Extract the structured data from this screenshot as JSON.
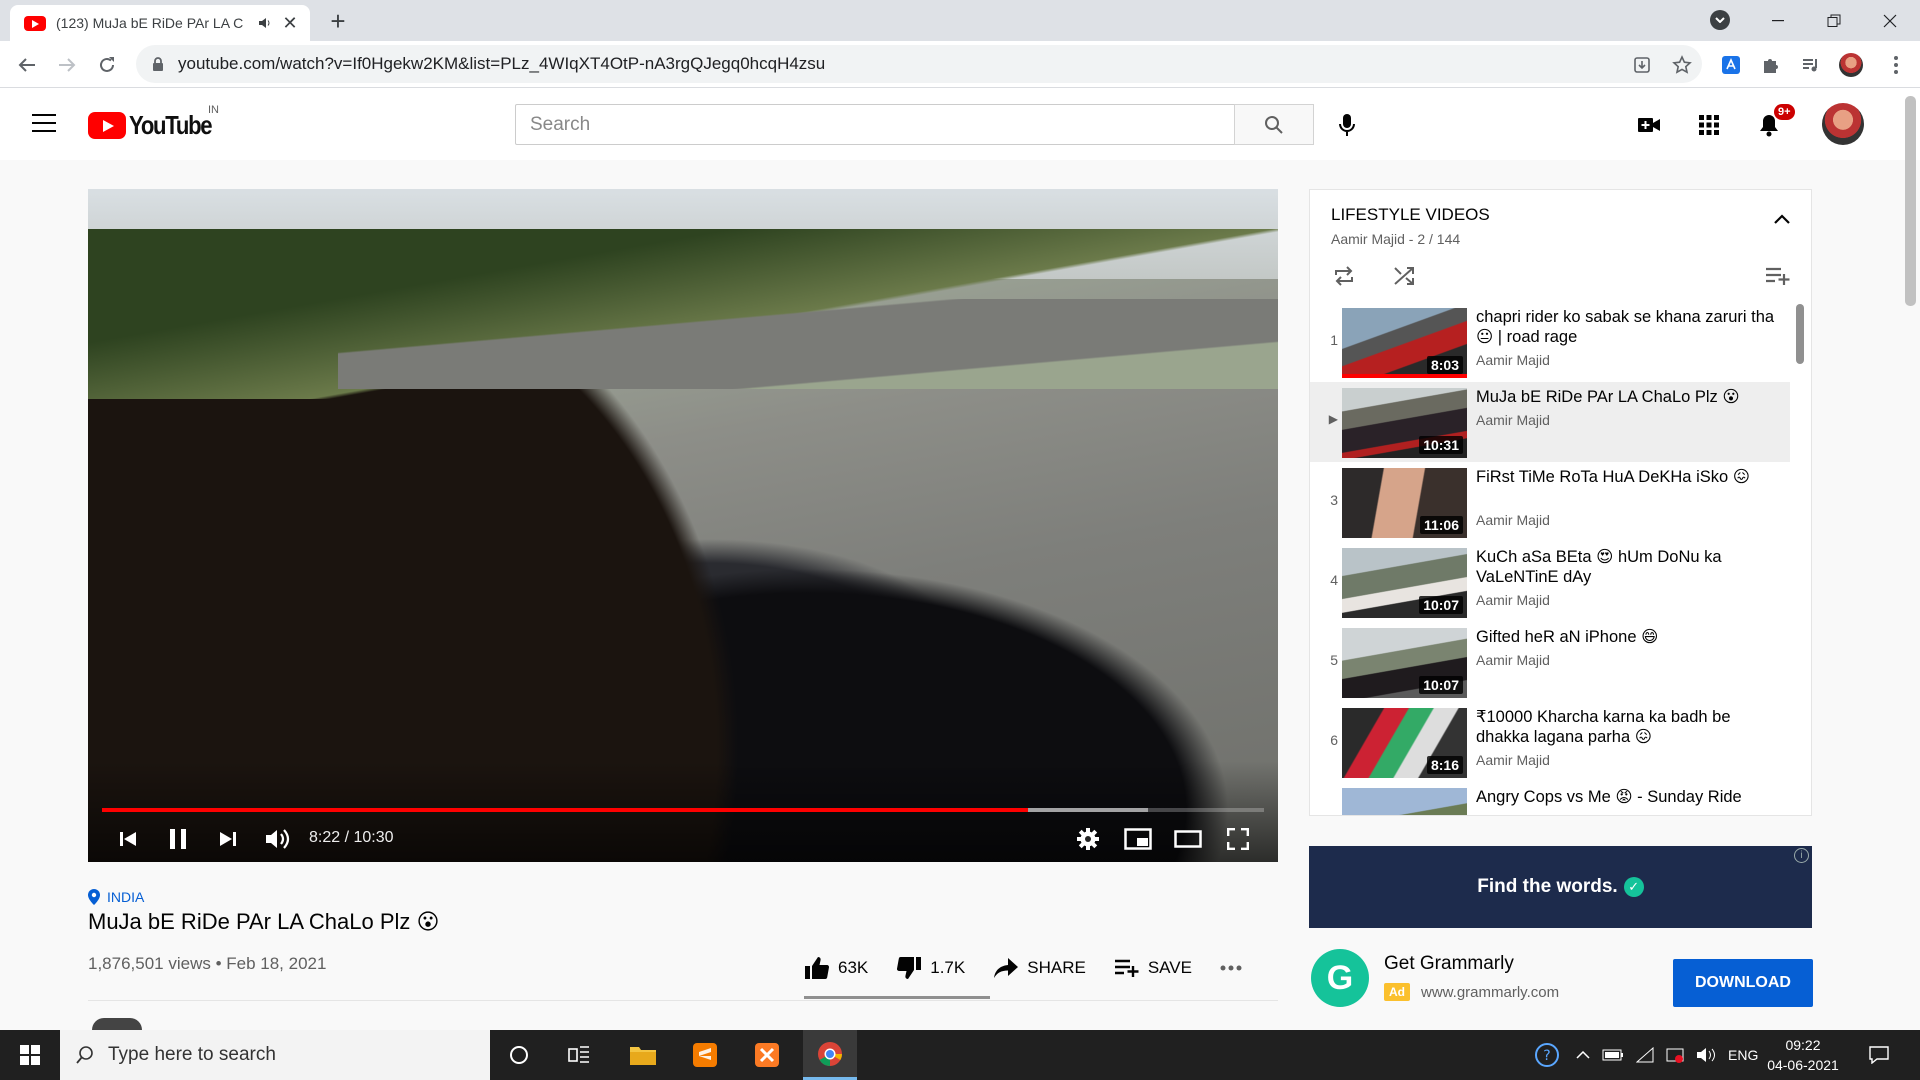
{
  "browser": {
    "tab_title": "(123) MuJa bE RiDe PAr LA C",
    "url": "youtube.com/watch?v=If0Hgekw2KM&list=PLz_4WIqXT4OtP-nA3rgQJegq0hcqH4zsu",
    "new_tab_label": "+",
    "tab_close_label": "✕"
  },
  "header": {
    "logo_text": "YouTube",
    "country": "IN",
    "search_placeholder": "Search",
    "notification_count": "9+"
  },
  "player": {
    "current_time": "8:22 / 10:30",
    "played_fraction": 0.797,
    "buffered_fraction": 0.9
  },
  "video": {
    "location": "INDIA",
    "title": "MuJa bE RiDe PAr LA ChaLo Plz 😮",
    "views_date": "1,876,501 views • Feb 18, 2021",
    "likes": "63K",
    "dislikes": "1.7K",
    "share_label": "SHARE",
    "save_label": "SAVE",
    "like_fraction": 0.974
  },
  "playlist": {
    "title": "LIFESTYLE VIDEOS",
    "subtitle": "Aamir Majid - 2 / 144",
    "items": [
      {
        "index": "1",
        "title": "chapri rider ko sabak se khana zaruri tha 😐 | road rage",
        "channel": "Aamir Majid",
        "duration": "8:03",
        "watched": true
      },
      {
        "index": "▶",
        "title": "MuJa bE RiDe PAr LA ChaLo Plz 😮",
        "channel": "Aamir Majid",
        "duration": "10:31",
        "active": true
      },
      {
        "index": "3",
        "title": "FiRst TiMe RoTa HuA DeKHa iSko 😖",
        "channel": "Aamir Majid",
        "duration": "11:06"
      },
      {
        "index": "4",
        "title": "KuCh aSa BEta 😍 hUm DoNu ka VaLeNTinE dAy",
        "channel": "Aamir Majid",
        "duration": "10:07"
      },
      {
        "index": "5",
        "title": "Gifted heR aN iPhone 😄",
        "channel": "Aamir Majid",
        "duration": "10:07"
      },
      {
        "index": "6",
        "title": "₹10000 Kharcha karna ka badh be dhakka lagana parha 😖",
        "channel": "Aamir Majid",
        "duration": "8:16"
      },
      {
        "index": "",
        "title": "Angry Cops vs Me 😡 - Sunday Ride",
        "channel": "",
        "duration": ""
      }
    ]
  },
  "ad": {
    "banner_text": "Find the words.",
    "banner_check": "✓",
    "info": "i",
    "logo_letter": "G",
    "name": "Get Grammarly",
    "tag": "Ad",
    "domain": "www.grammarly.com",
    "button": "DOWNLOAD"
  },
  "taskbar": {
    "search_placeholder": "Type here to search",
    "language": "ENG",
    "time": "09:22",
    "date": "04-06-2021"
  },
  "colors": {
    "accent_red": "#ff0000",
    "link_blue": "#065fd4",
    "grammarly_green": "#15c39a"
  }
}
